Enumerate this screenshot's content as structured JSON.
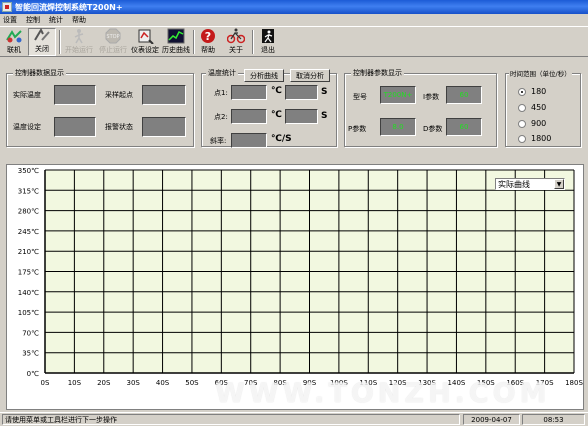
{
  "window": {
    "title": "智能回流焊控制系统T200N+"
  },
  "menu": [
    "设置",
    "控制",
    "统计",
    "帮助"
  ],
  "toolbar": [
    {
      "label": "联机",
      "icon": "connect-icon",
      "state": "normal"
    },
    {
      "label": "关闭",
      "icon": "close-connection-icon",
      "state": "pressed"
    },
    {
      "label": "开始运行",
      "icon": "run-icon",
      "state": "disabled"
    },
    {
      "label": "停止运行",
      "icon": "stop-icon",
      "state": "disabled"
    },
    {
      "label": "仪表设定",
      "icon": "meter-icon",
      "state": "normal"
    },
    {
      "label": "历史曲线",
      "icon": "history-chart-icon",
      "state": "normal"
    },
    {
      "label": "帮助",
      "icon": "help-icon",
      "state": "normal"
    },
    {
      "label": "关于",
      "icon": "bicycle-icon",
      "state": "normal"
    },
    {
      "label": "退出",
      "icon": "exit-icon",
      "state": "normal"
    }
  ],
  "controller_display": {
    "title": "控制器数据显示",
    "actual_temp": "实际温度",
    "sample_start": "采样起点",
    "temp_setting": "温度设定",
    "alarm_status": "报警状态"
  },
  "temp_stats": {
    "title": "温度统计",
    "analyze_btn": "分析曲线",
    "cancel_btn": "取消分析",
    "point1": "点1:",
    "point2": "点2:",
    "slope": "斜率:",
    "unit_c": "℃",
    "unit_s": "S",
    "unit_cs": "℃/S"
  },
  "controller_params": {
    "title": "控制器参数显示",
    "model": "型号",
    "model_value": "T200N+",
    "i_param": "I参数",
    "i_value": "60",
    "p_param": "P参数",
    "p_value": "8.0",
    "d_param": "D参数",
    "d_value": "60"
  },
  "time_range": {
    "title": "时间范围（单位/秒）",
    "options": [
      "180",
      "450",
      "900",
      "1800"
    ],
    "selected": "180"
  },
  "chart_data": {
    "type": "line",
    "title": "",
    "xlabel": "",
    "ylabel": "",
    "x_ticks": [
      "0S",
      "10S",
      "20S",
      "30S",
      "40S",
      "50S",
      "60S",
      "70S",
      "80S",
      "90S",
      "100S",
      "110S",
      "120S",
      "130S",
      "140S",
      "150S",
      "160S",
      "170S",
      "180S"
    ],
    "y_ticks": [
      "0℃",
      "35℃",
      "70℃",
      "105℃",
      "140℃",
      "175℃",
      "210℃",
      "245℃",
      "280℃",
      "315℃",
      "350℃"
    ],
    "xlim": [
      0,
      180
    ],
    "ylim": [
      0,
      350
    ],
    "grid": true,
    "series": [],
    "colors": {
      "plot_bg": "#f2f8e0",
      "grid": "#000000"
    },
    "dropdown_value": "实际曲线"
  },
  "status": {
    "message": "请使用菜单或工具栏进行下一步操作",
    "date": "2009-04-07",
    "time": "08:53"
  },
  "watermark": "WWW.TONZH.COM"
}
